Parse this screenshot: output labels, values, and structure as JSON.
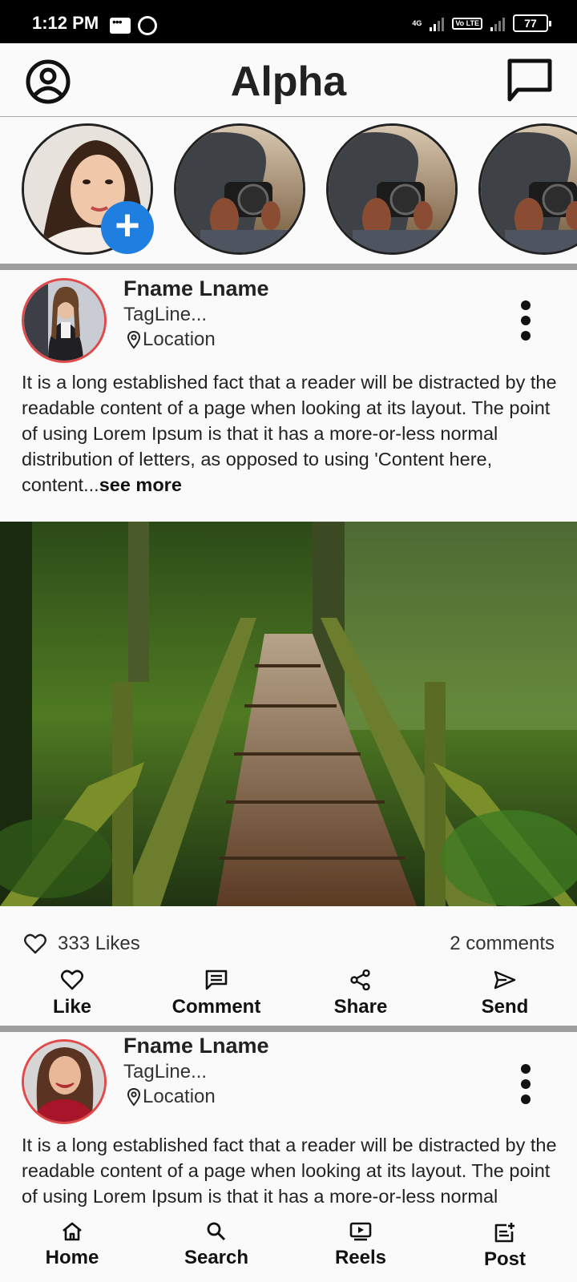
{
  "status_bar": {
    "time": "1:12 PM",
    "network": "4G",
    "volte": "Vo LTE",
    "battery": "77",
    "icons": [
      "message-icon",
      "whatsapp-icon",
      "signal-icon",
      "battery-icon"
    ]
  },
  "app_bar": {
    "title": "Alpha",
    "left_icon": "account-circle-icon",
    "right_icon": "chat-bubble-icon"
  },
  "stories": {
    "add_icon": "plus-icon",
    "items": [
      {
        "kind": "own-story",
        "icon": "woman-portrait-image"
      },
      {
        "kind": "story",
        "icon": "photographer-image"
      },
      {
        "kind": "story",
        "icon": "photographer-image"
      },
      {
        "kind": "story",
        "icon": "photographer-image"
      }
    ]
  },
  "posts": [
    {
      "author": "Fname Lname",
      "tagline": "TagLine...",
      "location": "Location",
      "text": "It is a long established fact that a reader will be distracted by the readable content of a page when looking at its layout. The point of using Lorem Ipsum is that it has a more-or-less normal distribution of letters, as opposed to using 'Content here, content...",
      "see_more": "see more",
      "image": "forest-bridge-image",
      "likes": "333 Likes",
      "comments": "2 comments"
    },
    {
      "author": "Fname Lname",
      "tagline": "TagLine...",
      "location": "Location",
      "text": "It is a long established fact that a reader will be distracted by the readable content of a page when looking at its layout. The point of using Lorem Ipsum is that it has a more-or-less normal distribution of letters"
    }
  ],
  "actions": [
    {
      "label": "Like",
      "icon": "heart-icon"
    },
    {
      "label": "Comment",
      "icon": "comment-icon"
    },
    {
      "label": "Share",
      "icon": "share-icon"
    },
    {
      "label": "Send",
      "icon": "send-icon"
    }
  ],
  "bottom_nav": [
    {
      "label": "Home",
      "icon": "home-icon"
    },
    {
      "label": "Search",
      "icon": "search-icon"
    },
    {
      "label": "Reels",
      "icon": "reels-icon"
    },
    {
      "label": "Post",
      "icon": "post-icon"
    }
  ],
  "colors": {
    "status_bar": "#000000",
    "background": "#fafafa",
    "divider": "#9e9e9e",
    "add_button": "#1e7fe0",
    "avatar_ring": "#e04a4a"
  }
}
